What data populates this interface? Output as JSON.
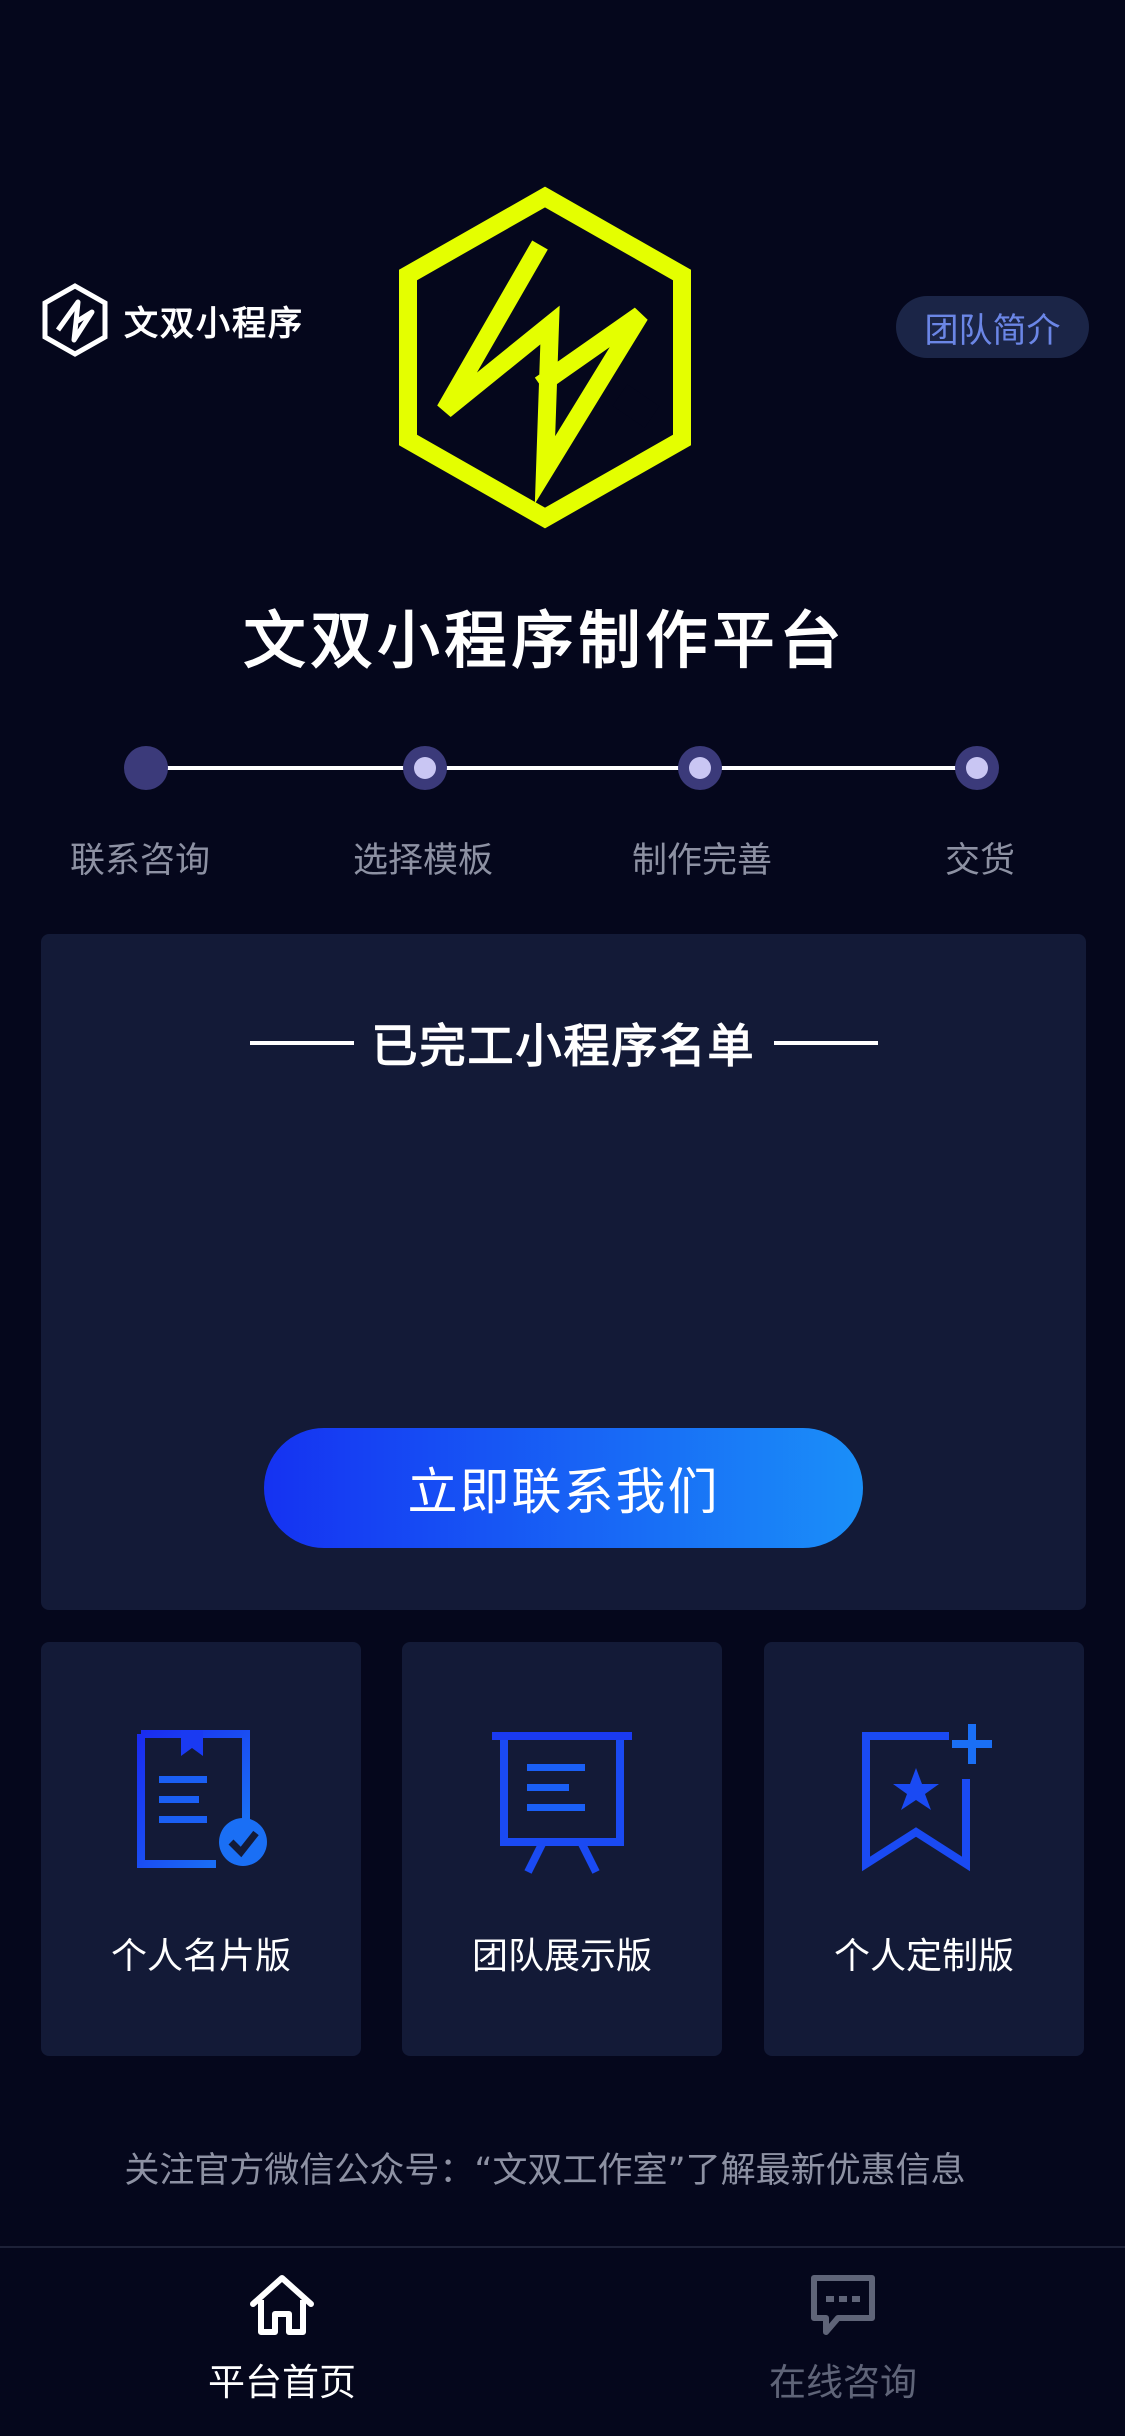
{
  "header": {
    "brand_name": "文双小程序",
    "team_button": "团队简介"
  },
  "hero": {
    "title": "文双小程序制作平台"
  },
  "steps": [
    {
      "label": "联系咨询"
    },
    {
      "label": "选择模板"
    },
    {
      "label": "制作完善"
    },
    {
      "label": "交货"
    }
  ],
  "completed": {
    "title": "已完工小程序名单",
    "contact_button": "立即联系我们"
  },
  "features": [
    {
      "label": "个人名片版",
      "icon": "card-check-icon"
    },
    {
      "label": "团队展示版",
      "icon": "presentation-board-icon"
    },
    {
      "label": "个人定制版",
      "icon": "bookmark-star-icon"
    }
  ],
  "notice": "关注官方微信公众号：“文双工作室”了解最新优惠信息",
  "tabbar": {
    "items": [
      {
        "label": "平台首页",
        "icon": "home-icon",
        "active": true
      },
      {
        "label": "在线咨询",
        "icon": "chat-icon",
        "active": false
      }
    ]
  },
  "colors": {
    "background": "#05071c",
    "card": "#131a37",
    "logo_accent": "#e4ff00",
    "icon_blue": "#1744f0",
    "button_gradient_start": "#1532f2",
    "button_gradient_end": "#1a8ff8"
  }
}
